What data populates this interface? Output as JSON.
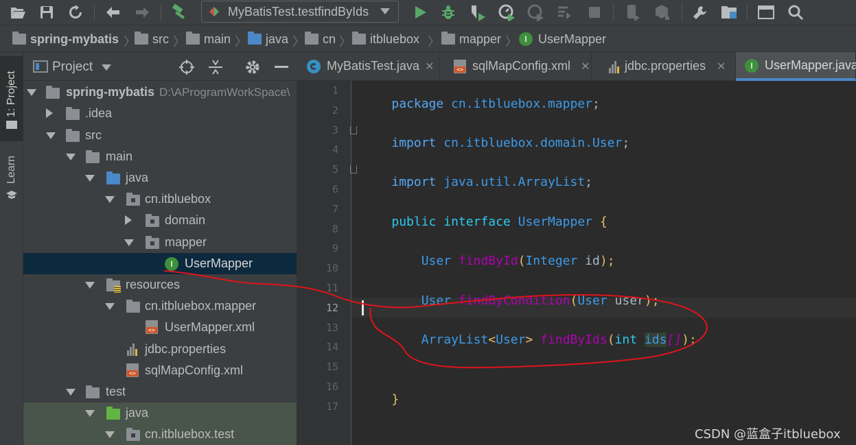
{
  "toolbar": {
    "run_config": "MyBatisTest.testfindByIds",
    "icons": [
      "open-icon",
      "save-icon",
      "sync-icon",
      "back-icon",
      "forward-icon",
      "build-icon",
      "run-icon",
      "debug-icon",
      "coverage-icon",
      "profile-icon",
      "attach-icon",
      "step-icon",
      "stop-icon",
      "device-icon",
      "sdk-icon",
      "settings-icon",
      "structure-icon",
      "terminal-icon",
      "search-icon"
    ]
  },
  "breadcrumb": {
    "items": [
      "spring-mybatis",
      "src",
      "main",
      "java",
      "cn",
      "itbluebox",
      "mapper",
      "UserMapper"
    ]
  },
  "left_strip": {
    "project_tab": "1: Project",
    "learn_tab": "Learn"
  },
  "project_panel": {
    "title": "Project",
    "tree": [
      {
        "label": "spring-mybatis",
        "suffix": "D:\\AProgramWorkSpace\\"
      },
      {
        "label": ".idea"
      },
      {
        "label": "src"
      },
      {
        "label": "main"
      },
      {
        "label": "java"
      },
      {
        "label": "cn.itbluebox"
      },
      {
        "label": "domain"
      },
      {
        "label": "mapper"
      },
      {
        "label": "UserMapper"
      },
      {
        "label": "resources"
      },
      {
        "label": "cn.itbluebox.mapper"
      },
      {
        "label": "UserMapper.xml"
      },
      {
        "label": "jdbc.properties"
      },
      {
        "label": "sqlMapConfig.xml"
      },
      {
        "label": "test"
      },
      {
        "label": "java"
      },
      {
        "label": "cn.itbluebox.test"
      }
    ]
  },
  "tabs": [
    {
      "label": "MyBatisTest.java"
    },
    {
      "label": "sqlMapConfig.xml"
    },
    {
      "label": "jdbc.properties"
    },
    {
      "label": "UserMapper.java"
    }
  ],
  "editor": {
    "line_numbers": [
      "1",
      "2",
      "3",
      "4",
      "5",
      "6",
      "7",
      "8",
      "9",
      "10",
      "11",
      "12",
      "13",
      "14",
      "15",
      "16",
      "17"
    ],
    "current_line": "12",
    "lines": {
      "l1_kw": "package",
      "l1_pkg": "cn.itbluebox.mapper",
      "l1_end": ";",
      "l3_kw": "import",
      "l3_pkg": "cn.itbluebox.domain.User",
      "l3_end": ";",
      "l5_kw": "import",
      "l5_pkg": "java.util.ArrayList",
      "l5_end": ";",
      "l7_kw1": "public",
      "l7_kw2": "interface",
      "l7_name": "UserMapper",
      "l7_brace": "{",
      "l9_type": "User",
      "l9_method": "findById",
      "l9_open": "(",
      "l9_ptype": "Integer",
      "l9_param": "id",
      "l9_close": ");",
      "l11_type": "User",
      "l11_method": "findByCondition",
      "l11_open": "(",
      "l11_ptype": "User",
      "l11_param": "user",
      "l11_close": ");",
      "l13_type": "ArrayList",
      "l13_gen_open": "<",
      "l13_gen": "User",
      "l13_gen_close": ">",
      "l13_method": "findByIds",
      "l13_open": "(",
      "l13_ptype": "int",
      "l13_param": "ids",
      "l13_arr": "[]",
      "l13_close": ");",
      "l16_brace": "}"
    }
  },
  "watermark": "CSDN @蓝盒子itbluebox",
  "colors": {
    "annotation": "#e0141b",
    "selection": "#0d293e",
    "tab_underline": "#4a88c7"
  }
}
